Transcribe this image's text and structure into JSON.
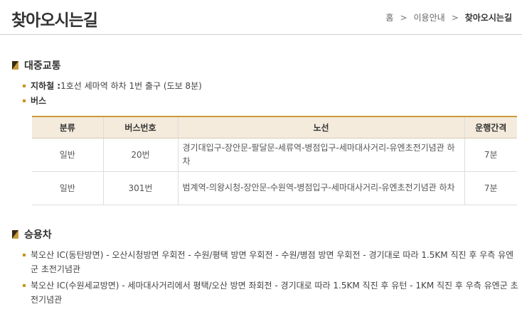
{
  "header": {
    "title": "찾아오시는길",
    "breadcrumb": [
      "홈",
      "이용안내",
      "찾아오시는길"
    ]
  },
  "sections": {
    "transit_title": "대중교통",
    "car_title": "승용차"
  },
  "transit": {
    "subway_label": "지하철 :",
    "subway_text": "1호선 세마역 하차 1번 출구 (도보 8분)",
    "bus_label": "버스"
  },
  "bus_table": {
    "headers": [
      "분류",
      "버스번호",
      "노선",
      "운행간격"
    ],
    "rows": [
      {
        "type": "일반",
        "number": "20번",
        "route": "경기대입구-장안문-팔달문-세류역-병점입구-세마대사거리-유엔초전기념관 하차",
        "interval": "7분"
      },
      {
        "type": "일반",
        "number": "301번",
        "route": "범계역-의왕시청-장안문-수원역-병점입구-세마대사거리-유엔초전기념관 하차",
        "interval": "7분"
      }
    ]
  },
  "car": {
    "lines": [
      "북오산 IC(동탄방면) - 오산시청방면 우회전 - 수원/평택 방면 우회전 - 수원/병점 방면 우회전 - 경기대로 따라 1.5KM 직진 후 우측 유엔군 초전기념관",
      "북오산 IC(수원세교방면) - 세마대사거리에서 평택/오산 방면 좌회전 - 경기대로 따라 1.5KM 직진 후 유턴 - 1KM 직진 후 우측 유엔군 초전기념관"
    ]
  },
  "colors": {
    "accent": "#c89a3c",
    "icon_dark": "#3a2a10",
    "table_header_bg": "#f4ebdc"
  },
  "icons": {
    "section": "section-marker-icon",
    "breadcrumb_sep": "chevron-right-icon"
  }
}
